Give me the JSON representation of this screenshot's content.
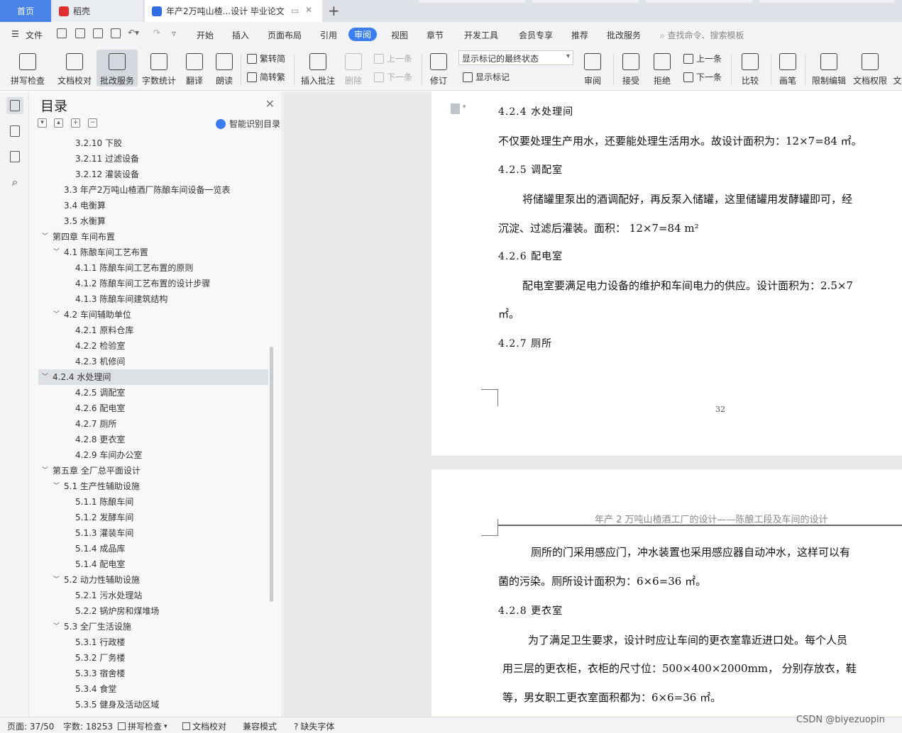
{
  "tabs": {
    "home": "首页",
    "daoke": "稻壳",
    "document": "年产2万吨山楂...设计 毕业论文",
    "new_tab": "+"
  },
  "menu": {
    "file": "文件",
    "items": [
      "开始",
      "插入",
      "页面布局",
      "引用",
      "审阅",
      "视图",
      "章节",
      "开发工具",
      "会员专享",
      "推荐",
      "批改服务"
    ],
    "active": "审阅",
    "search_placeholder": "查找命令、搜索模板"
  },
  "toolbar": {
    "spellcheck": "拼写检查",
    "proofread": "文档校对",
    "correction_service": "批改服务",
    "word_count": "字数统计",
    "translate": "翻译",
    "read_aloud": "朗读",
    "trad_to_simp": "繁转简",
    "simp_to_trad": "简转繁",
    "insert_comment": "插入批注",
    "delete": "删除",
    "prev_comment": "上一条",
    "next_comment": "下一条",
    "track_changes": "修订",
    "markup_state": "显示标记的最终状态",
    "show_markup": "显示标记",
    "review": "审阅",
    "accept": "接受",
    "reject": "拒绝",
    "prev_change": "上一条",
    "next_change": "下一条",
    "compare": "比较",
    "ink": "画笔",
    "restrict_edit": "限制编辑",
    "doc_permission": "文档权限",
    "cut_text": "文"
  },
  "toc": {
    "title": "目录",
    "smart_detect": "智能识别目录",
    "items": [
      {
        "label": "3.2.10 下胶",
        "level": 3
      },
      {
        "label": "3.2.11 过滤设备",
        "level": 3
      },
      {
        "label": "3.2.12 灌装设备",
        "level": 3
      },
      {
        "label": "3.3 年产2万吨山楂酒厂陈酿车间设备一览表",
        "level": 2
      },
      {
        "label": "3.4 电衡算",
        "level": 2
      },
      {
        "label": "3.5 水衡算",
        "level": 2
      },
      {
        "label": "第四章  车间布置",
        "level": 1
      },
      {
        "label": "4.1 陈酿车间工艺布置",
        "level": 2
      },
      {
        "label": "4.1.1 陈酿车间工艺布置的原则",
        "level": 3
      },
      {
        "label": "4.1.2 陈酿车间工艺布置的设计步骤",
        "level": 3
      },
      {
        "label": "4.1.3 陈酿车间建筑结构",
        "level": 3
      },
      {
        "label": "4.2  车间辅助单位",
        "level": 2
      },
      {
        "label": "4.2.1 原料仓库",
        "level": 3
      },
      {
        "label": "4.2.2 检验室",
        "level": 3
      },
      {
        "label": "4.2.3  机修间",
        "level": 3
      },
      {
        "label": "4.2.4 水处理间",
        "level": 1,
        "selected": true
      },
      {
        "label": "4.2.5 调配室",
        "level": 3
      },
      {
        "label": "4.2.6 配电室",
        "level": 3
      },
      {
        "label": "4.2.7 厕所",
        "level": 3
      },
      {
        "label": "4.2.8 更衣室",
        "level": 3
      },
      {
        "label": "4.2.9 车间办公室",
        "level": 3
      },
      {
        "label": "第五章  全厂总平面设计",
        "level": 1
      },
      {
        "label": "5.1 生产性辅助设施",
        "level": 2
      },
      {
        "label": "5.1.1 陈酿车间",
        "level": 3
      },
      {
        "label": "5.1.2 发酵车间",
        "level": 3
      },
      {
        "label": "5.1.3 灌装车间",
        "level": 3
      },
      {
        "label": "5.1.4 成品库",
        "level": 3
      },
      {
        "label": "5.1.4 配电室",
        "level": 3
      },
      {
        "label": "5.2 动力性辅助设施",
        "level": 2
      },
      {
        "label": "5.2.1 污水处理站",
        "level": 3
      },
      {
        "label": "5.2.2 锅炉房和煤堆场",
        "level": 3
      },
      {
        "label": "5.3 全厂生活设施",
        "level": 2
      },
      {
        "label": "5.3.1 行政楼",
        "level": 3
      },
      {
        "label": "5.3.2 厂务楼",
        "level": 3
      },
      {
        "label": "5.3.3 宿舍楼",
        "level": 3
      },
      {
        "label": "5.3.4 食堂",
        "level": 3
      },
      {
        "label": "5.3.5 健身及活动区域",
        "level": 3
      }
    ]
  },
  "document": {
    "page1": {
      "h_424": "4.2.4 水处理间",
      "p_424": "不仅要处理生产用水，还要能处理生活用水。故设计面积为：12×7=84 ㎡。",
      "h_425": "4.2.5 调配室",
      "p_425_1": "将储罐里泵出的酒调配好，再反泵入储罐，这里储罐用发酵罐即可，经",
      "p_425_2": "沉淀、过滤后灌装。面积：  12×7=84  m²",
      "h_426": "4.2.6 配电室",
      "p_426_1": "配电室要满足电力设备的维护和车间电力的供应。设计面积为：2.5×7",
      "p_426_2": "㎡。",
      "h_427": "4.2.7 厕所",
      "page_number": "32"
    },
    "page2": {
      "header": "年产 2 万吨山楂酒工厂的设计——陈酿工段及车间的设计",
      "p_427_1": "厕所的门采用感应门，冲水装置也采用感应器自动冲水，这样可以有",
      "p_427_2": "菌的污染。厕所设计面积为：6×6=36 ㎡。",
      "h_428": "4.2.8 更衣室",
      "p_428_1": "为了满足卫生要求，设计时应让车间的更衣室靠近进口处。每个人员",
      "p_428_2": "用三层的更衣柜，衣柜的尺寸位：500×400×2000mm， 分别存放衣，鞋",
      "p_428_3": "等，男女职工更衣室面积都为：6×6=36 ㎡。"
    }
  },
  "status": {
    "page": "页面: 37/50",
    "words": "字数: 18253",
    "spellcheck": "拼写检查",
    "proofread": "文档校对",
    "compat": "兼容模式",
    "missing_font": "缺失字体"
  },
  "watermark": "CSDN @biyezuopin"
}
